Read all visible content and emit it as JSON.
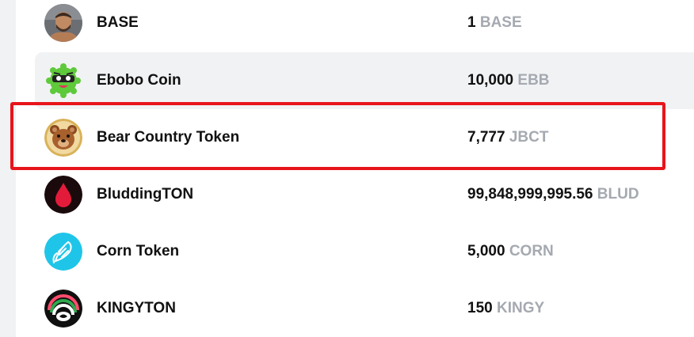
{
  "tokens": [
    {
      "name": "BASE",
      "amount": "1",
      "symbol": "BASE",
      "icon": "base-avatar-icon"
    },
    {
      "name": "Ebobo Coin",
      "amount": "10,000",
      "symbol": "EBB",
      "icon": "ebobo-coin-icon"
    },
    {
      "name": "Bear Country Token",
      "amount": "7,777",
      "symbol": "JBCT",
      "icon": "bear-icon"
    },
    {
      "name": "BluddingTON",
      "amount": "99,848,999,995.56",
      "symbol": "BLUD",
      "icon": "blood-drop-icon"
    },
    {
      "name": "Corn Token",
      "amount": "5,000",
      "symbol": "CORN",
      "icon": "corn-icon"
    },
    {
      "name": "KINGYTON",
      "amount": "150",
      "symbol": "KINGY",
      "icon": "kingy-icon"
    }
  ],
  "colors": {
    "highlight": "#e8141b",
    "symbol": "#a5a9b0",
    "hover_row": "#f1f2f4"
  }
}
